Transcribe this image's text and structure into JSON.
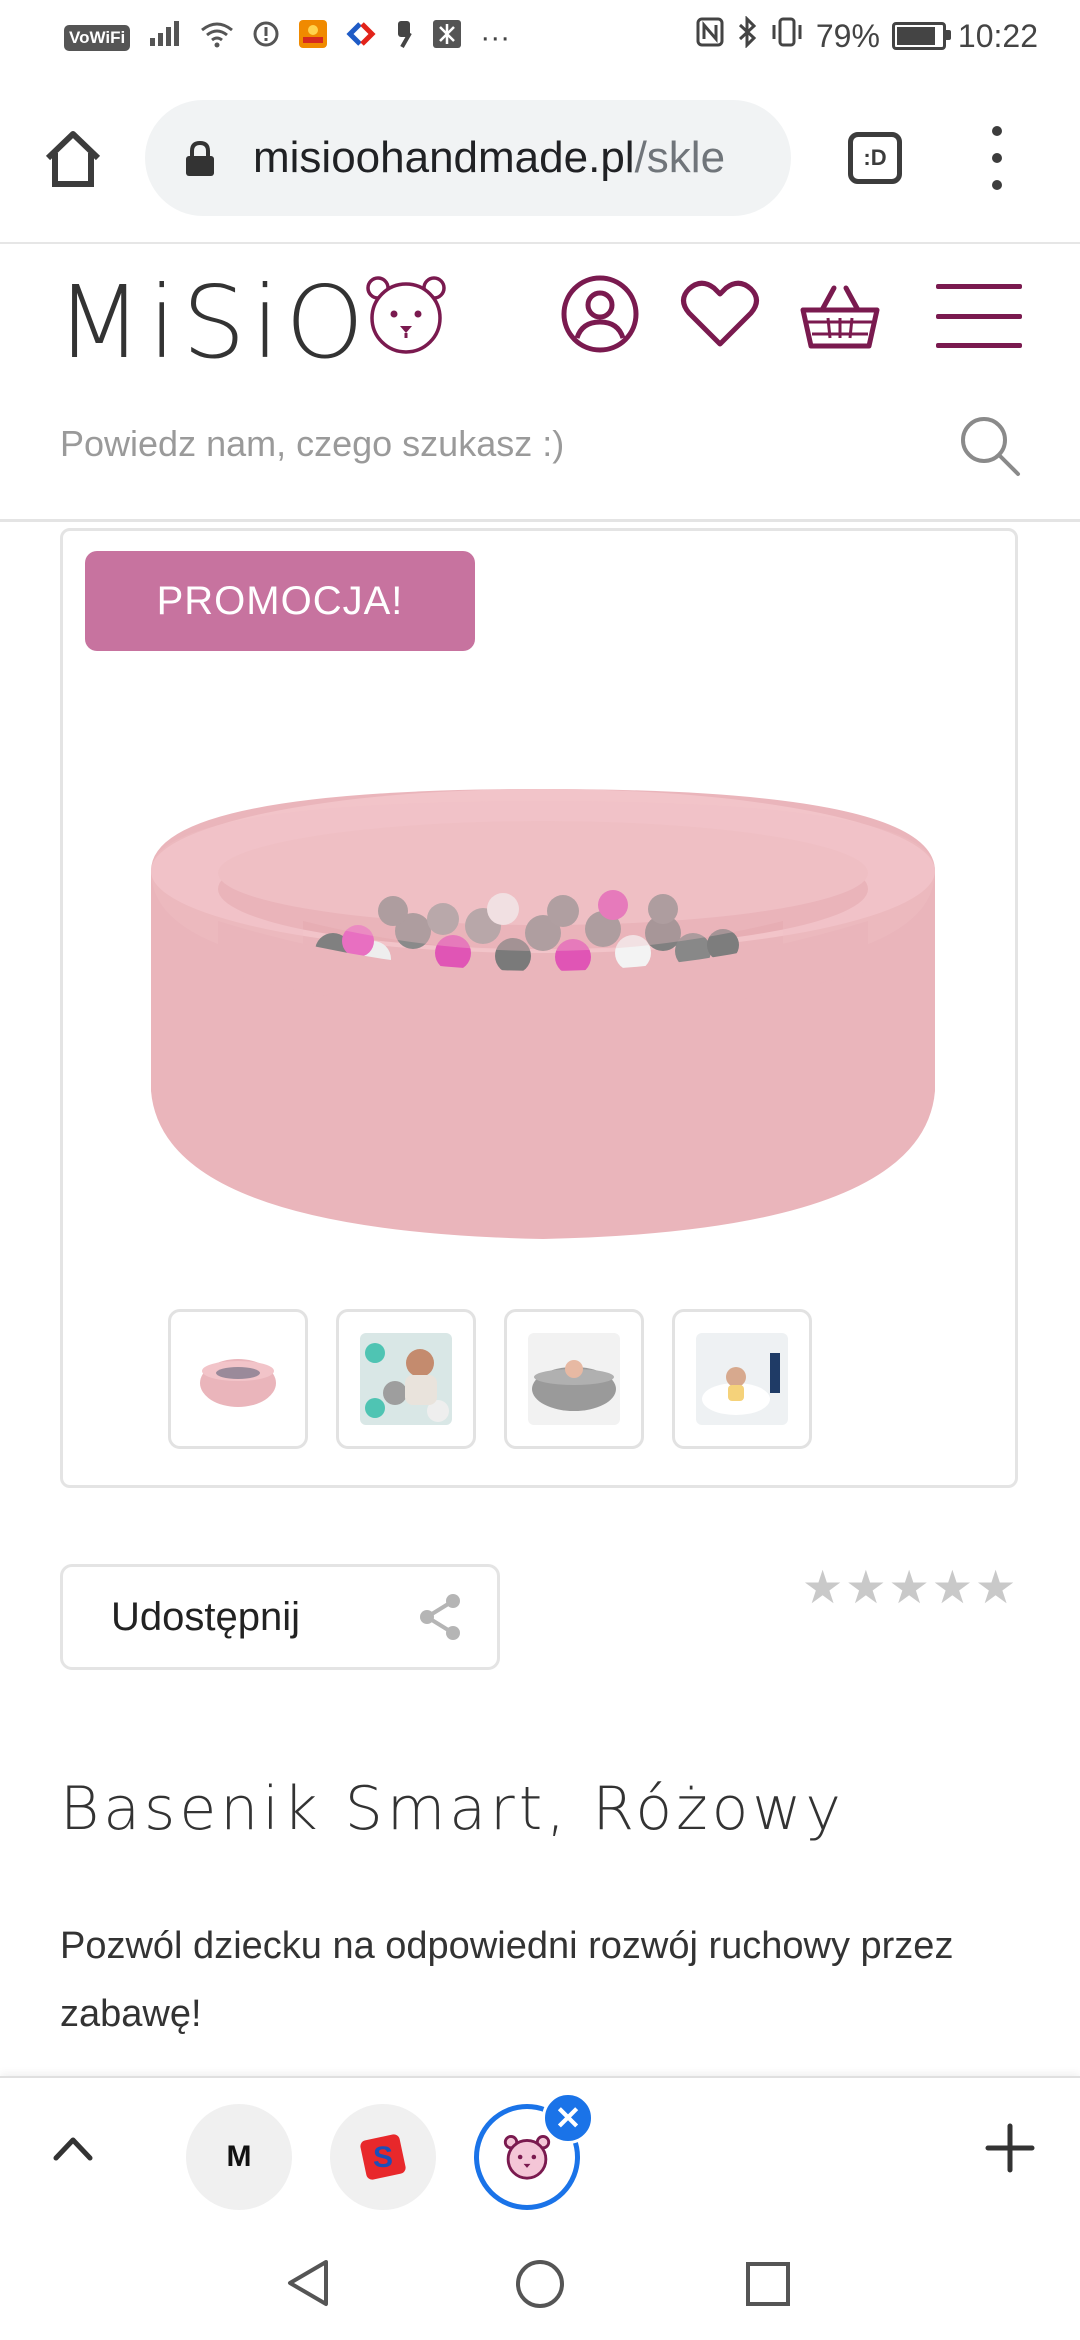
{
  "status_bar": {
    "vowifi": "VoWiFi",
    "battery": "79%",
    "battery_level": 0.79,
    "time": "10:22",
    "more": "···"
  },
  "browser": {
    "url_host": "misioohandmade.pl",
    "url_path": "/skle",
    "tabs_label": ":D"
  },
  "site": {
    "logo": "MiSiO",
    "brand_color": "#7a1a4f",
    "search_placeholder": "Powiedz nam, czego szukasz :)"
  },
  "product": {
    "badge": "PROMOCJA!",
    "badge_color": "#c7739f",
    "thumbnails": [
      "thumb-pink-pool",
      "thumb-child-balls",
      "thumb-grey-pool",
      "thumb-room-scene"
    ],
    "share_label": "Udostępnij",
    "rating_stars": [
      "★",
      "★",
      "★",
      "★",
      "★"
    ],
    "title": "Basenik Smart, Różowy",
    "description": "Pozwól dziecku na odpowiedni rozwój ruchowy przez zabawę!"
  },
  "tab_strip": {
    "tab1_letter": "M",
    "tab2_letter": "S",
    "close": "✕"
  }
}
